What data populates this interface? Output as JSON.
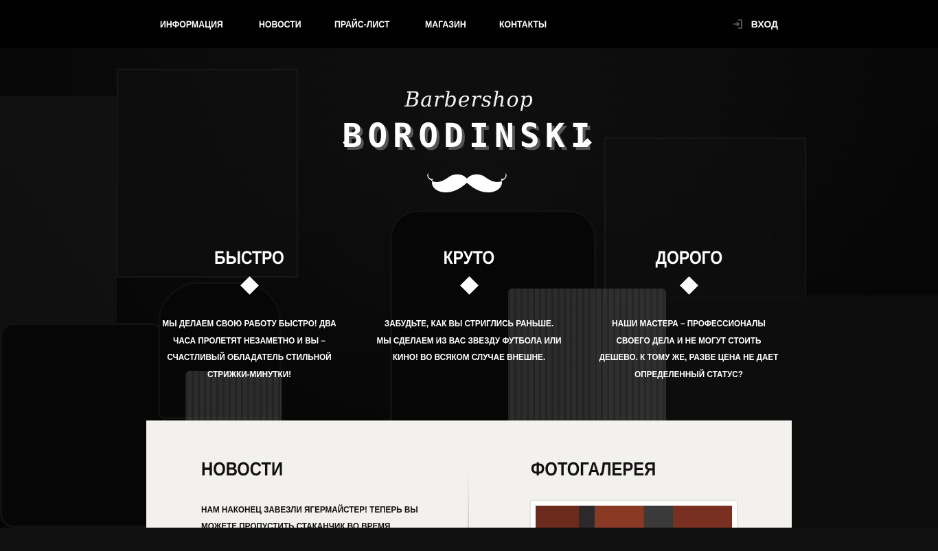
{
  "nav": {
    "items": [
      "ИНФОРМАЦИЯ",
      "НОВОСТИ",
      "ПРАЙС-ЛИСТ",
      "МАГАЗИН",
      "КОНТАКТЫ"
    ],
    "login_label": "ВХОД",
    "login_icon": "sign-in-icon"
  },
  "brand": {
    "script": "Barbershop",
    "name": "BORODINSKI",
    "logo_icon": "mustache-icon"
  },
  "features": [
    {
      "title": "БЫСТРО",
      "text": "МЫ ДЕЛАЕМ СВОЮ РАБОТУ БЫСТРО! ДВА ЧАСА ПРОЛЕТЯТ НЕЗАМЕТНО И ВЫ – СЧАСТЛИВЫЙ ОБЛАДАТЕЛЬ СТИЛЬНОЙ СТРИЖКИ-МИНУТКИ!"
    },
    {
      "title": "КРУТО",
      "text": "ЗАБУДЬТЕ, КАК ВЫ СТРИГЛИСЬ РАНЬШЕ. МЫ СДЕЛАЕМ ИЗ ВАС ЗВЕЗДУ ФУТБОЛА ИЛИ КИНО! ВО ВСЯКОМ СЛУЧАЕ ВНЕШНЕ."
    },
    {
      "title": "ДОРОГО",
      "text": "НАШИ МАСТЕРА – ПРОФЕССИОНАЛЫ СВОЕГО ДЕЛА И НЕ МОГУТ СТОИТЬ ДЕШЕВО. К ТОМУ ЖЕ, РАЗВЕ ЦЕНА НЕ ДАЕТ ОПРЕДЕЛЕННЫЙ СТАТУС?"
    }
  ],
  "news": {
    "title": "НОВОСТИ",
    "text": "НАМ НАКОНЕЦ ЗАВЕЗЛИ ЯГЕРМАЙСТЕР! ТЕПЕРЬ ВЫ МОЖЕТЕ ПРОПУСТИТЬ СТАКАНЧИК ВО ВРЕМЯ СТРИЖКИ"
  },
  "gallery": {
    "title": "ФОТОГАЛЕРЕЯ"
  }
}
